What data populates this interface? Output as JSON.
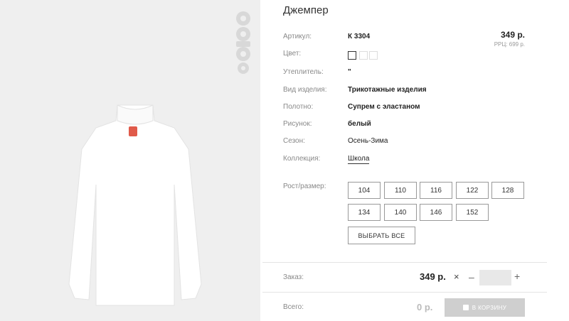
{
  "brand": {
    "logo_text": "orby"
  },
  "product": {
    "title": "Джемпер",
    "price": "349 р.",
    "rrc": "РРЦ: 699 р.",
    "fields": [
      {
        "label": "Артикул:",
        "value": "К 3304"
      },
      {
        "label": "Цвет:",
        "value": ""
      },
      {
        "label": "Утеплитель:",
        "value": "\""
      },
      {
        "label": "Вид изделия:",
        "value": "Трикотажные изделия"
      },
      {
        "label": "Полотно:",
        "value": "Супрем с эластаном"
      },
      {
        "label": "Рисунок:",
        "value": "белый"
      },
      {
        "label": "Сезон:",
        "value": "Осень-Зима"
      },
      {
        "label": "Коллекция:",
        "value": "Школа"
      }
    ],
    "colors": [
      "#ffffff",
      "#ffffff",
      "#ffffff"
    ]
  },
  "sizes": {
    "label": "Рост/размер:",
    "options": [
      "104",
      "110",
      "116",
      "122",
      "128",
      "134",
      "140",
      "146",
      "152"
    ],
    "select_all": "ВЫБРАТЬ ВСЕ"
  },
  "order": {
    "label": "Заказ:",
    "price": "349 р.",
    "times": "×",
    "minus": "–",
    "plus": "+",
    "qty": ""
  },
  "total": {
    "label": "Всего:",
    "value": "0 р.",
    "cart_button": "В КОРЗИНУ"
  }
}
